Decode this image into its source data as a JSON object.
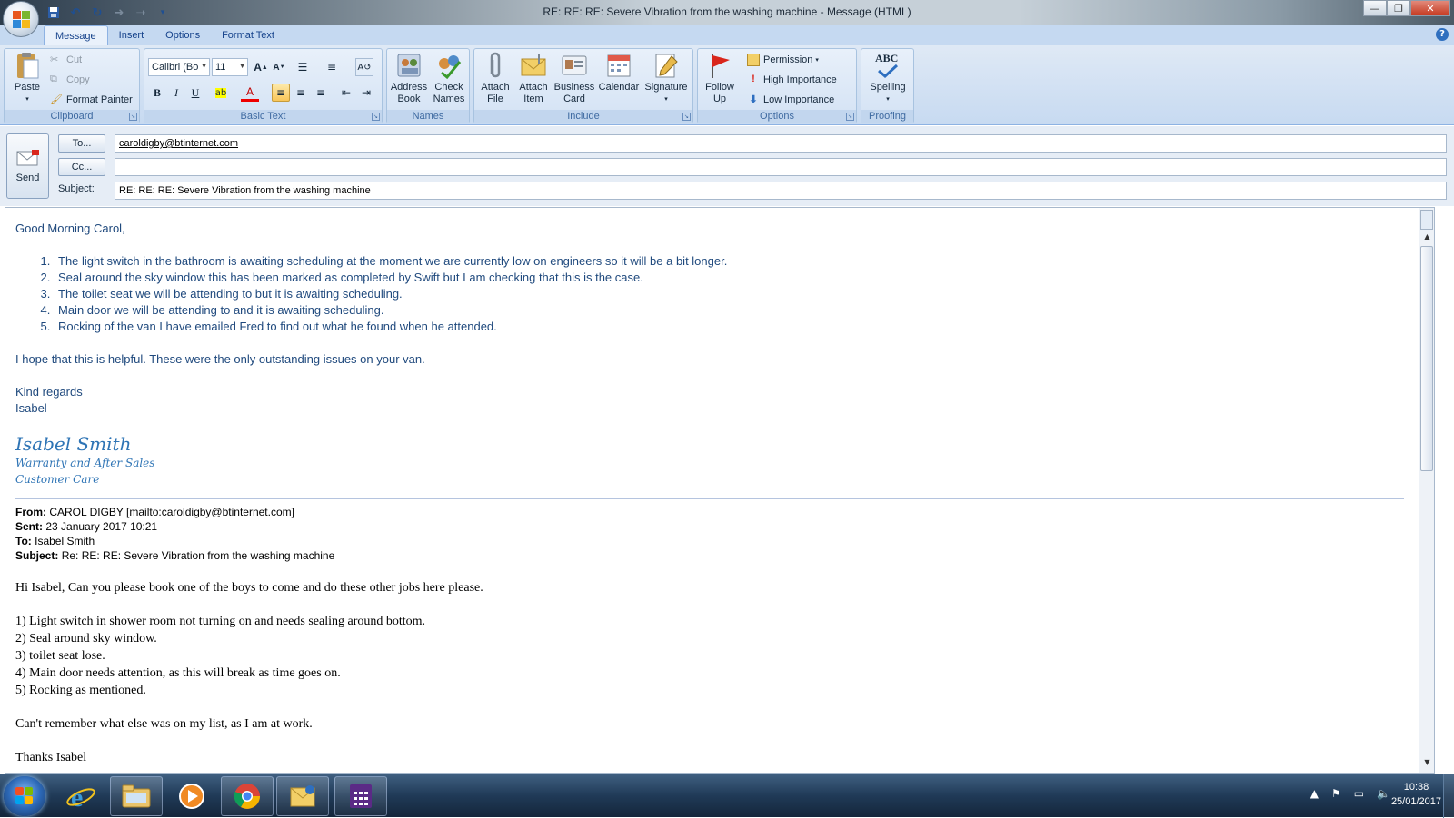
{
  "window": {
    "title": "RE: RE: RE: Severe Vibration from the washing machine - Message (HTML)",
    "controls": {
      "minimize": "—",
      "maximize": "❐",
      "close": "✕"
    }
  },
  "ribbon": {
    "tabs": [
      {
        "label": "Message",
        "active": true
      },
      {
        "label": "Insert"
      },
      {
        "label": "Options"
      },
      {
        "label": "Format Text"
      }
    ],
    "help": "?",
    "groups": {
      "clipboard": {
        "label": "Clipboard",
        "paste": "Paste",
        "cut": "Cut",
        "copy": "Copy",
        "format_painter": "Format Painter"
      },
      "basic_text": {
        "label": "Basic Text",
        "font": "Calibri (Bo",
        "size": "11",
        "bold": "B",
        "italic": "I",
        "underline": "U"
      },
      "names": {
        "label": "Names",
        "address_book_1": "Address",
        "address_book_2": "Book",
        "check_names_1": "Check",
        "check_names_2": "Names"
      },
      "include": {
        "label": "Include",
        "attach_file_1": "Attach",
        "attach_file_2": "File",
        "attach_item_1": "Attach",
        "attach_item_2": "Item",
        "business_card_1": "Business",
        "business_card_2": "Card",
        "calendar": "Calendar",
        "signature": "Signature"
      },
      "options": {
        "label": "Options",
        "follow_up_1": "Follow",
        "follow_up_2": "Up",
        "permission": "Permission",
        "high_importance": "High Importance",
        "low_importance": "Low Importance"
      },
      "proofing": {
        "label": "Proofing",
        "spelling": "Spelling",
        "abc": "ABC"
      }
    }
  },
  "compose": {
    "send": "Send",
    "to_button": "To...",
    "cc_button": "Cc...",
    "subject_label": "Subject:",
    "to_value": "caroldigby@btinternet.com",
    "cc_value": "",
    "subject_value": "RE: RE: RE: Severe Vibration from the washing machine"
  },
  "body": {
    "greeting": "Good Morning Carol,",
    "items": [
      "The light switch in the bathroom is awaiting scheduling at the moment we are currently low on engineers so it will be a bit longer.",
      "Seal around the sky window this has been marked as completed by Swift but I am checking that this is the case.",
      "The toilet seat we will be attending to but it is awaiting scheduling.",
      "Main door we will be attending to and it is awaiting scheduling.",
      "Rocking of the van I have emailed Fred to find out what he found when he attended."
    ],
    "closing_line": "I hope that this is helpful. These were the only outstanding issues on your van.",
    "kind_regards": "Kind regards",
    "first_name": "Isabel",
    "signature": {
      "name": "Isabel Smith",
      "line1": "Warranty and After Sales",
      "line2": "Customer Care"
    },
    "original": {
      "from_label": "From:",
      "from_value": "CAROL DIGBY [mailto:caroldigby@btinternet.com]",
      "sent_label": "Sent:",
      "sent_value": "23 January 2017 10:21",
      "to_label": "To:",
      "to_value": "Isabel Smith",
      "subject_label": "Subject:",
      "subject_value": "Re: RE: RE: Severe Vibration from the washing machine",
      "intro": "Hi Isabel, Can you please book one of the boys to come and do these other jobs here please.",
      "items": [
        "1)  Light switch in shower room not turning on and needs sealing around bottom.",
        "2)  Seal around sky window.",
        "3)  toilet seat lose.",
        "4)  Main door needs attention, as this will break as time goes on.",
        "5)  Rocking as mentioned."
      ],
      "note": "Can't remember what else was on my list, as I am at work.",
      "thanks": "Thanks Isabel"
    }
  },
  "taskbar": {
    "apps": [
      "internet-explorer",
      "file-explorer",
      "media-player",
      "chrome",
      "outlook",
      "calculator"
    ],
    "time": "10:38",
    "date": "25/01/2017"
  }
}
